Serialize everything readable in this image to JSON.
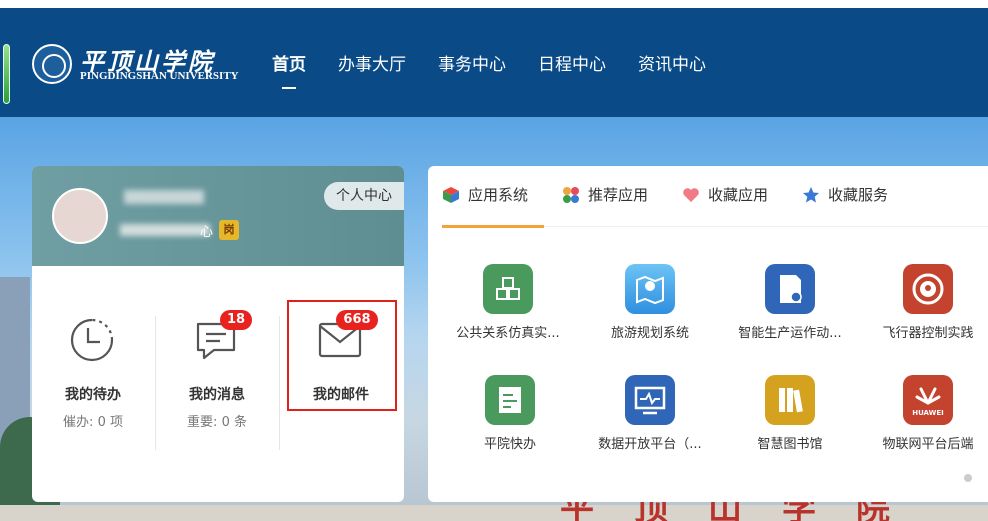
{
  "header": {
    "logo_cn": "平顶山学院",
    "logo_en": "PINGDINGSHAN UNIVERSITY",
    "nav": [
      {
        "label": "首页",
        "active": true
      },
      {
        "label": "办事大厅"
      },
      {
        "label": "事务中心"
      },
      {
        "label": "日程中心"
      },
      {
        "label": "资讯中心"
      }
    ]
  },
  "profile": {
    "name": "",
    "dept_suffix": "心",
    "role_badge": "岗",
    "center_button": "个人中心"
  },
  "tiles": [
    {
      "label": "我的待办",
      "sub_label": "催办:",
      "sub_value": "0 项"
    },
    {
      "label": "我的消息",
      "sub_label": "重要:",
      "sub_value": "0 条",
      "badge": "18"
    },
    {
      "label": "我的邮件",
      "badge": "668"
    }
  ],
  "tabs": [
    {
      "label": "应用系统",
      "icon": "cube-icon",
      "active": true
    },
    {
      "label": "推荐应用",
      "icon": "flower-icon"
    },
    {
      "label": "收藏应用",
      "icon": "heart-icon"
    },
    {
      "label": "收藏服务",
      "icon": "star-icon"
    }
  ],
  "apps": [
    {
      "label": "公共关系仿真实...",
      "color": "#4a9a5e",
      "icon": "boxes-icon"
    },
    {
      "label": "旅游规划系统",
      "color": "#3a95e0",
      "icon": "map-pin-icon"
    },
    {
      "label": "智能生产运作动...",
      "color": "#2f66b8",
      "icon": "document-icon"
    },
    {
      "label": "飞行器控制实践",
      "color": "#c4432f",
      "icon": "target-icon"
    },
    {
      "label": "平院快办",
      "color": "#4a9a5e",
      "icon": "form-icon"
    },
    {
      "label": "数据开放平台（...",
      "color": "#2f66b8",
      "icon": "monitor-icon"
    },
    {
      "label": "智慧图书馆",
      "color": "#d4a21f",
      "icon": "books-icon"
    },
    {
      "label": "物联网平台后端",
      "color": "#c4432f",
      "icon": "huawei-icon",
      "brand": "HUAWEI"
    }
  ],
  "background_text": "平顶山学院"
}
